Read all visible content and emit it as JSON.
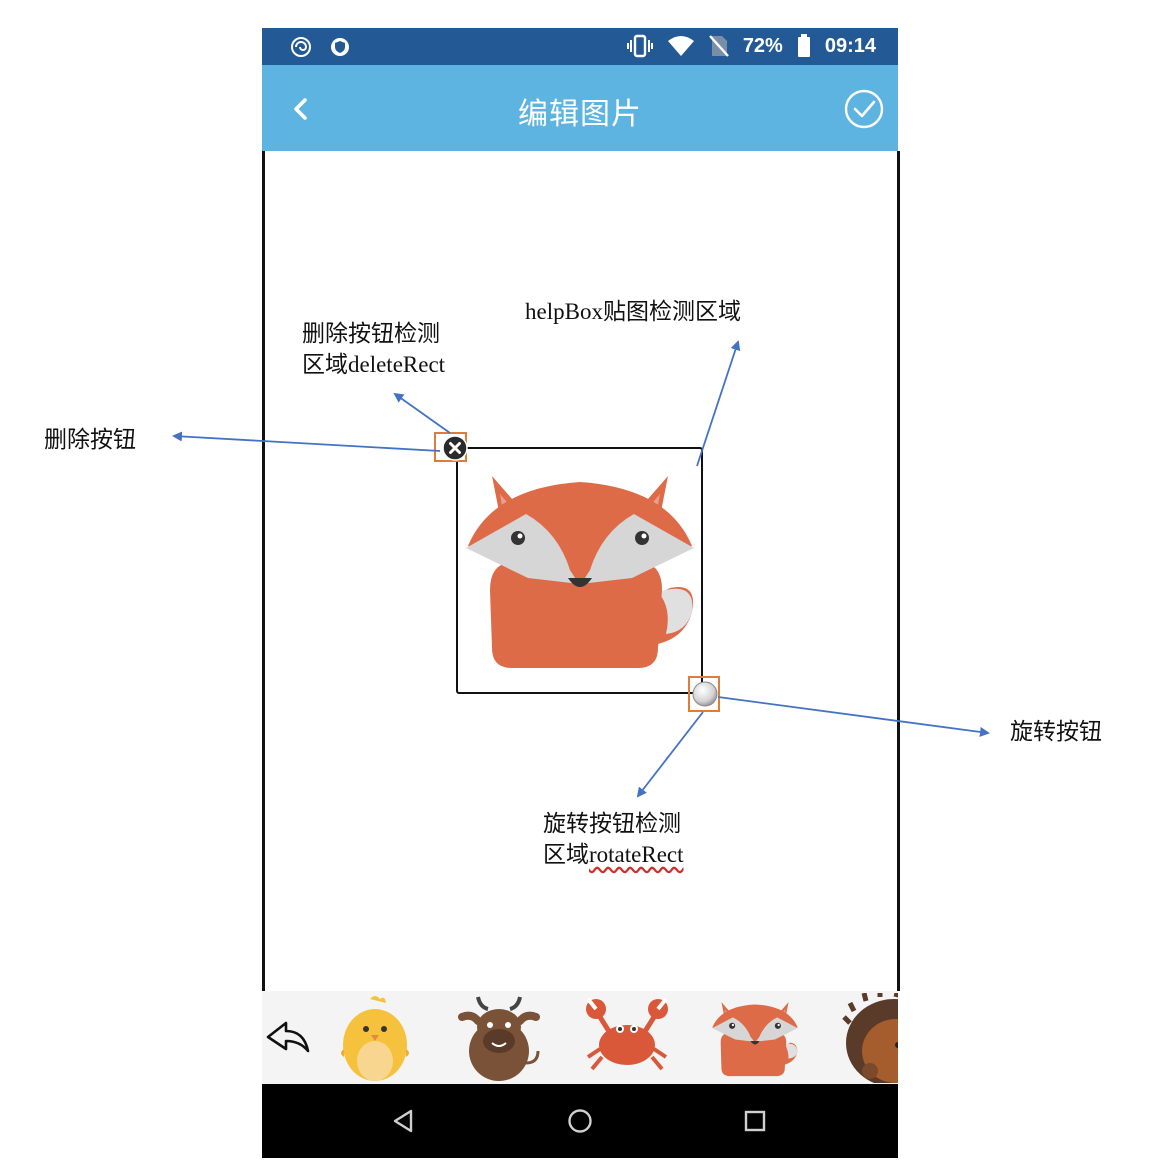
{
  "status_bar": {
    "battery": "72%",
    "time": "09:14"
  },
  "app_bar": {
    "title": "编辑图片"
  },
  "annotations": {
    "delete_rect_line1": "删除按钮检测",
    "delete_rect_line2_prefix": "区域",
    "delete_rect_line2_code": "deleteRect",
    "helpbox": "helpBox贴图检测区域",
    "delete_button": "删除按钮",
    "rotate_button": "旋转按钮",
    "rotate_rect_line1": "旋转按钮检测",
    "rotate_rect_line2_prefix": "区域",
    "rotate_rect_line2_code": "rotateRect"
  },
  "stickers": [
    "chick-sticker",
    "ox-sticker",
    "crab-sticker",
    "fox-sticker",
    "hedgehog-sticker"
  ],
  "colors": {
    "status_bar": "#235a95",
    "app_bar": "#5db4e1",
    "detect_rect": "#e07b3a",
    "arrow": "#4472c4",
    "fox_orange": "#dd6b48"
  }
}
